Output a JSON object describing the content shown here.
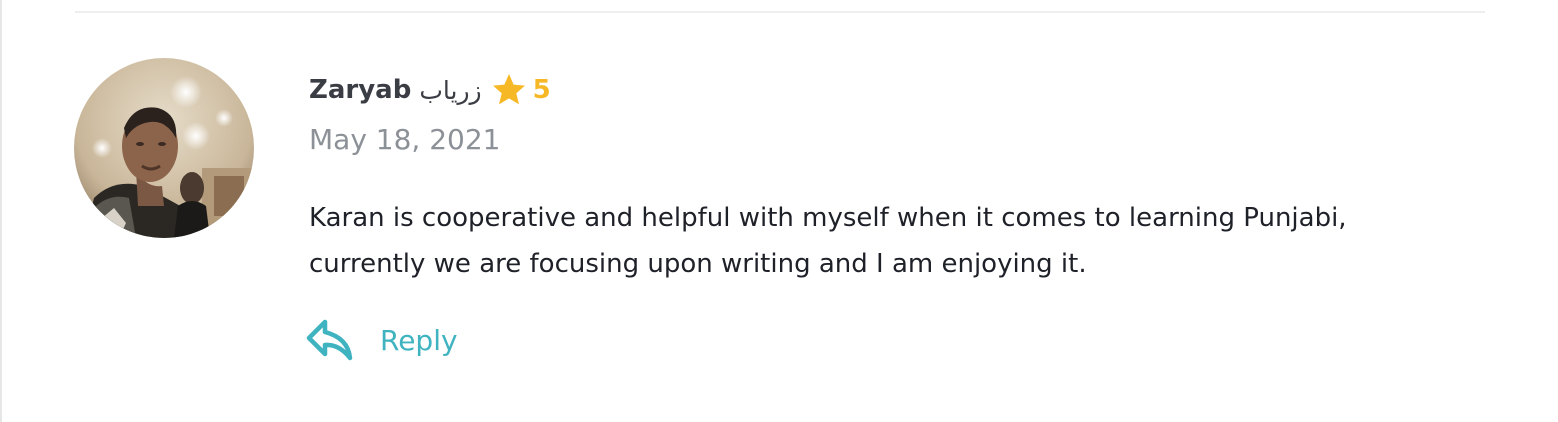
{
  "review": {
    "reviewer_name": "Zaryab",
    "reviewer_name_alt": "زریاب",
    "rating": "5",
    "date": "May 18, 2021",
    "text": "Karan is cooperative and helpful with myself when it comes to learning Punjabi, currently we are focusing upon writing and I am enjoying it.",
    "reply_label": "Reply"
  },
  "icons": {
    "rating": "star-icon",
    "reply": "reply-arrow-icon"
  },
  "colors": {
    "star": "#f6b925",
    "accent": "#3fb3c0",
    "name_text": "#3b3d44",
    "date_text": "#8c9198",
    "body_text": "#1f2129"
  }
}
